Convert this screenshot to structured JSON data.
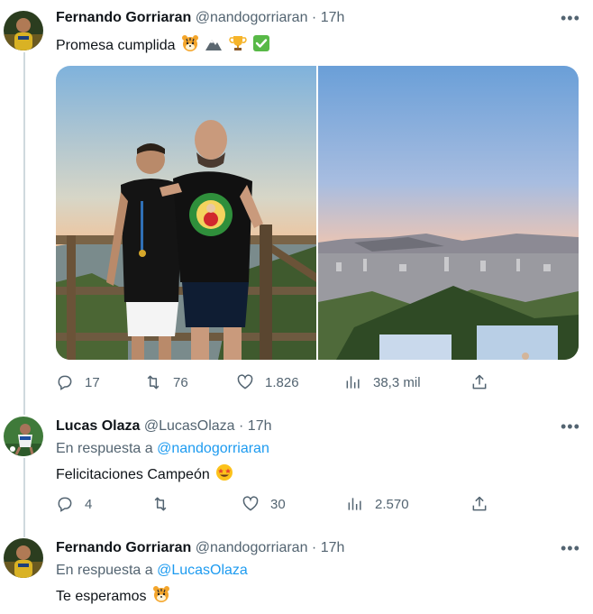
{
  "tweets": [
    {
      "name": "Fernando Gorriaran",
      "handle": "@nandogorriaran",
      "sep": "·",
      "time": "17h",
      "text": "Promesa cumplida",
      "emojis": [
        "tiger-face",
        "mountain",
        "trophy",
        "check-mark"
      ],
      "actions": {
        "replies": "17",
        "retweets": "76",
        "likes": "1.826",
        "views": "38,3 mil"
      }
    },
    {
      "name": "Lucas Olaza",
      "handle": "@LucasOlaza",
      "sep": "·",
      "time": "17h",
      "reply_prefix": "En respuesta a",
      "reply_to": "@nandogorriaran",
      "text": "Felicitaciones Campeón",
      "emojis": [
        "star-struck"
      ],
      "actions": {
        "replies": "4",
        "retweets": "",
        "likes": "30",
        "views": "2.570"
      }
    },
    {
      "name": "Fernando Gorriaran",
      "handle": "@nandogorriaran",
      "sep": "·",
      "time": "17h",
      "reply_prefix": "En respuesta a",
      "reply_to": "@LucasOlaza",
      "text": "Te esperamos",
      "emojis": [
        "tiger-face"
      ]
    }
  ],
  "more_label": "•••",
  "colors": {
    "link": "#1d9bf0",
    "secondary": "#536471",
    "line": "#cfd9de"
  }
}
